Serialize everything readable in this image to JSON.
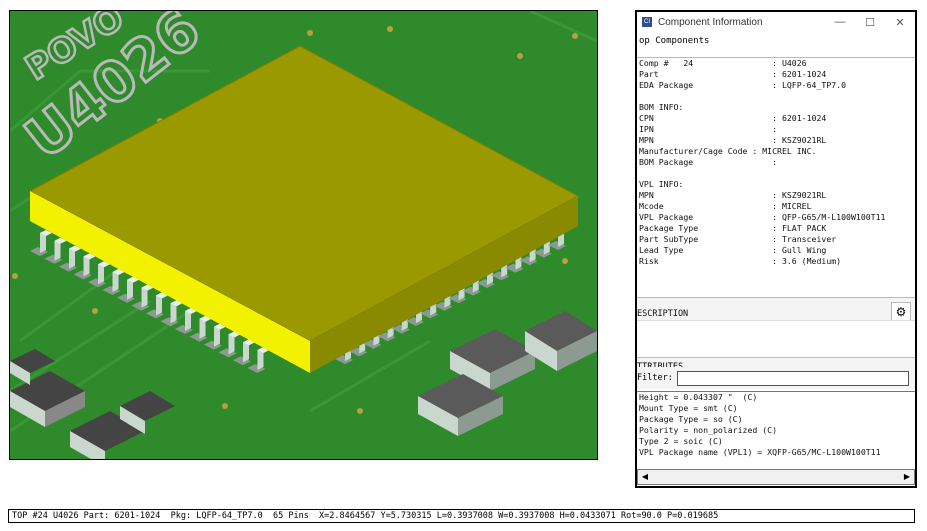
{
  "window": {
    "title": "Component Information",
    "icon": "app-icon",
    "minimize": "—",
    "maximize": "☐",
    "close": "✕"
  },
  "component_selector": "op Components",
  "info_lines": [
    "Comp #   24                : U4026",
    "Part                       : 6201-1024",
    "EDA Package                : LQFP-64_TP7.0",
    "",
    "BOM INFO:",
    "CPN                        : 6201-1024",
    "IPN                        :",
    "MPN                        : KSZ9021RL",
    "Manufacturer/Cage Code : MICREL INC.",
    "BOM Package                :",
    "",
    "VPL INFO:",
    "MPN                        : KSZ9021RL",
    "Mcode                      : MICREL",
    "VPL Package                : QFP-G65/M-L100W100T11",
    "Package Type               : FLAT PACK",
    "Part SubType               : Transceiver",
    "Lead Type                  : Gull Wing",
    "Risk                       : 3.6 (Medium)"
  ],
  "description_label": "ESCRIPTION",
  "attributes_label": "TTRIBUTES",
  "filter_label": "Filter:",
  "filter_value": "",
  "attributes": [
    "Height = 0.043307 \"  (C)",
    "Mount Type = smt (C)",
    "Package Type = so (C)",
    "Polarity = non_polarized (C)",
    "Type 2 = soic (C)",
    "VPL Package name (VPL1) = XQFP-G65/MC-L100W100T11"
  ],
  "board_silkscreen": {
    "refdes": "U4026",
    "side_text": "POVO"
  },
  "status_bar": "TOP #24 U4026 Part: 6201-1024  Pkg: LQFP-64_TP7.0  65 Pins  X=2.8464567 Y=5.730315 L=0.3937008 W=0.3937008 H=0.0433071 Rot=90.0 P=0.019685",
  "colors": {
    "board": "#2f8a2c",
    "chip_top": "#9a9a00",
    "chip_side": "#f2f200",
    "pads": "#c9d7cf"
  }
}
